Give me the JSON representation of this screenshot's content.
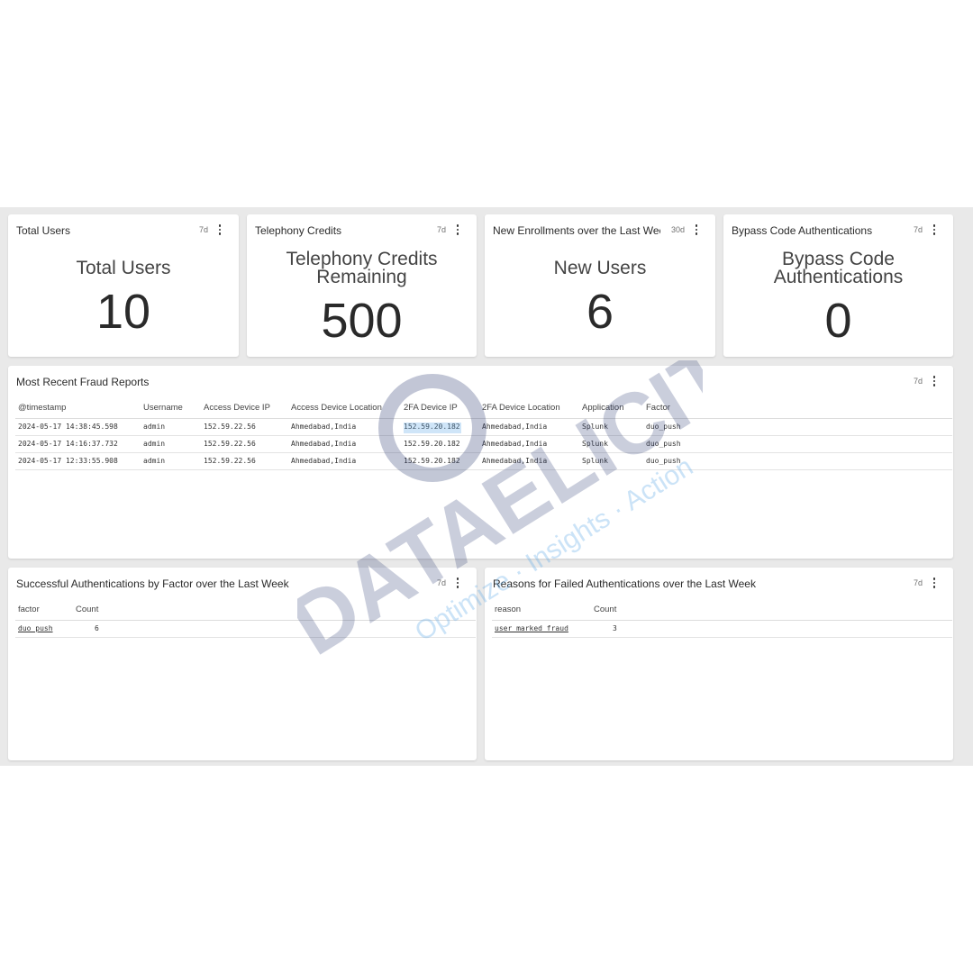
{
  "panels": {
    "total_users": {
      "title": "Total Users",
      "range": "7d",
      "label": "Total Users",
      "value": "10"
    },
    "telephony": {
      "title": "Telephony Credits",
      "range": "7d",
      "label_line1": "Telephony Credits",
      "label_line2": "Remaining",
      "value": "500"
    },
    "enrollments": {
      "title": "New Enrollments over the Last Week",
      "range": "30d",
      "label": "New Users",
      "value": "6"
    },
    "bypass": {
      "title": "Bypass Code Authentications",
      "range": "7d",
      "label_line1": "Bypass Code",
      "label_line2": "Authentications",
      "value": "0"
    }
  },
  "fraud": {
    "title": "Most Recent Fraud Reports",
    "range": "7d",
    "headers": [
      "@timestamp",
      "Username",
      "Access Device IP",
      "Access Device Location",
      "2FA Device IP",
      "2FA Device Location",
      "Application",
      "Factor"
    ],
    "rows": [
      [
        "2024-05-17 14:38:45.598",
        "admin",
        "152.59.22.56",
        "Ahmedabad,India",
        "152.59.20.182",
        "Ahmedabad,India",
        "Splunk",
        "duo_push"
      ],
      [
        "2024-05-17 14:16:37.732",
        "admin",
        "152.59.22.56",
        "Ahmedabad,India",
        "152.59.20.182",
        "Ahmedabad,India",
        "Splunk",
        "duo_push"
      ],
      [
        "2024-05-17 12:33:55.908",
        "admin",
        "152.59.22.56",
        "Ahmedabad,India",
        "152.59.20.182",
        "Ahmedabad,India",
        "Splunk",
        "duo_push"
      ]
    ]
  },
  "success_auth": {
    "title": "Successful Authentications by Factor over the Last Week",
    "range": "7d",
    "headers": [
      "factor",
      "Count"
    ],
    "rows": [
      [
        "duo_push",
        "6"
      ]
    ]
  },
  "failed_auth": {
    "title": "Reasons for Failed Authentications over the Last Week",
    "range": "7d",
    "headers": [
      "reason",
      "Count"
    ],
    "rows": [
      [
        "user_marked_fraud",
        "3"
      ]
    ]
  },
  "watermark": {
    "brand": "DATAELICIT",
    "tagline": "Optimize · Insights · Action"
  },
  "colors": {
    "background": "#e9e9e9",
    "panel": "#ffffff",
    "watermark_dark": "#2f3d73",
    "watermark_light": "#5aa6e6"
  }
}
